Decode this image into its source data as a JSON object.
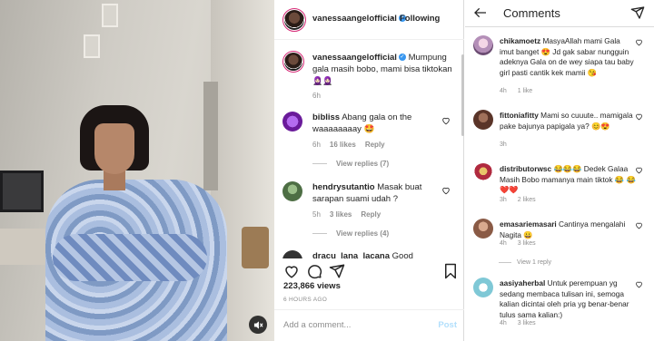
{
  "post": {
    "header": {
      "username": "vanessaangelofficial",
      "separator": "•",
      "follow_label": "Following"
    },
    "caption": {
      "username": "vanessaangelofficial",
      "text": " Mumpung gala masih bobo, mami bisa tiktokan",
      "emoji": "🧕🏻🧕🏻",
      "time": "6h"
    },
    "comments": [
      {
        "username": "bibliss",
        "text": " Abang gala on the waaaaaaaay 🤩",
        "time": "6h",
        "likes": "16 likes",
        "reply": "Reply",
        "view_replies": "View replies (7)",
        "avatar_color": "#7b2cbf"
      },
      {
        "username": "hendrysutantio",
        "text": " Masak buat sarapan suami udah ?",
        "time": "5h",
        "likes": "3 likes",
        "reply": "Reply",
        "view_replies": "View replies (4)",
        "avatar_color": "#6b8f5e"
      },
      {
        "username": "dracu_lana_lacana",
        "text": " Good",
        "time": "",
        "likes": "",
        "reply": "",
        "view_replies": "",
        "avatar_color": "#333333"
      }
    ],
    "stats": {
      "views": "223,866 views",
      "time": "6 HOURS AGO"
    },
    "add_comment": {
      "placeholder": "Add a comment...",
      "post_label": "Post"
    },
    "icons": {
      "like": "heart-icon",
      "comment": "comment-icon",
      "share": "share-icon",
      "save": "bookmark-icon",
      "mute": "muted-speaker-icon"
    }
  },
  "comments_panel": {
    "title": "Comments",
    "items": [
      {
        "username": "chikamoetz",
        "text": " MasyaAllah mami Gala imut banget 😍 Jd gak sabar nungguin adeknya Gala on de wey siapa tau baby girl pasti cantik kek mamii 😘",
        "time": "4h",
        "likes": "1 like",
        "replies": "",
        "avatar_color": "#c8a2c8"
      },
      {
        "username": "fittoniafitty",
        "text": " Mami so cuuute.. mamigala pake bajunya papigala ya? 😊😍",
        "time": "3h",
        "likes": "",
        "replies": "",
        "avatar_color": "#7a4b3a"
      },
      {
        "username": "distributorwsc",
        "text": " 😂😂😂 Dedek Galaa Masih Bobo mamanya main tiktok 😂 😂❤️❤️",
        "time": "3h",
        "likes": "2 likes",
        "replies": "",
        "avatar_color": "#8b1e2d"
      },
      {
        "username": "emasariemasari",
        "text": " Cantinya mengalahi Nagita 😀",
        "time": "4h",
        "likes": "3 likes",
        "replies": "View 1 reply",
        "avatar_color": "#b07a62"
      },
      {
        "username": "aasiyaherbal",
        "text": " Untuk perempuan yg sedang membaca tulisan ini, semoga kalian dicintai oleh pria yg benar-benar tulus sama kalian:)",
        "time": "4h",
        "likes": "3 likes",
        "replies": "",
        "avatar_color": "#7fc8d6"
      }
    ]
  }
}
